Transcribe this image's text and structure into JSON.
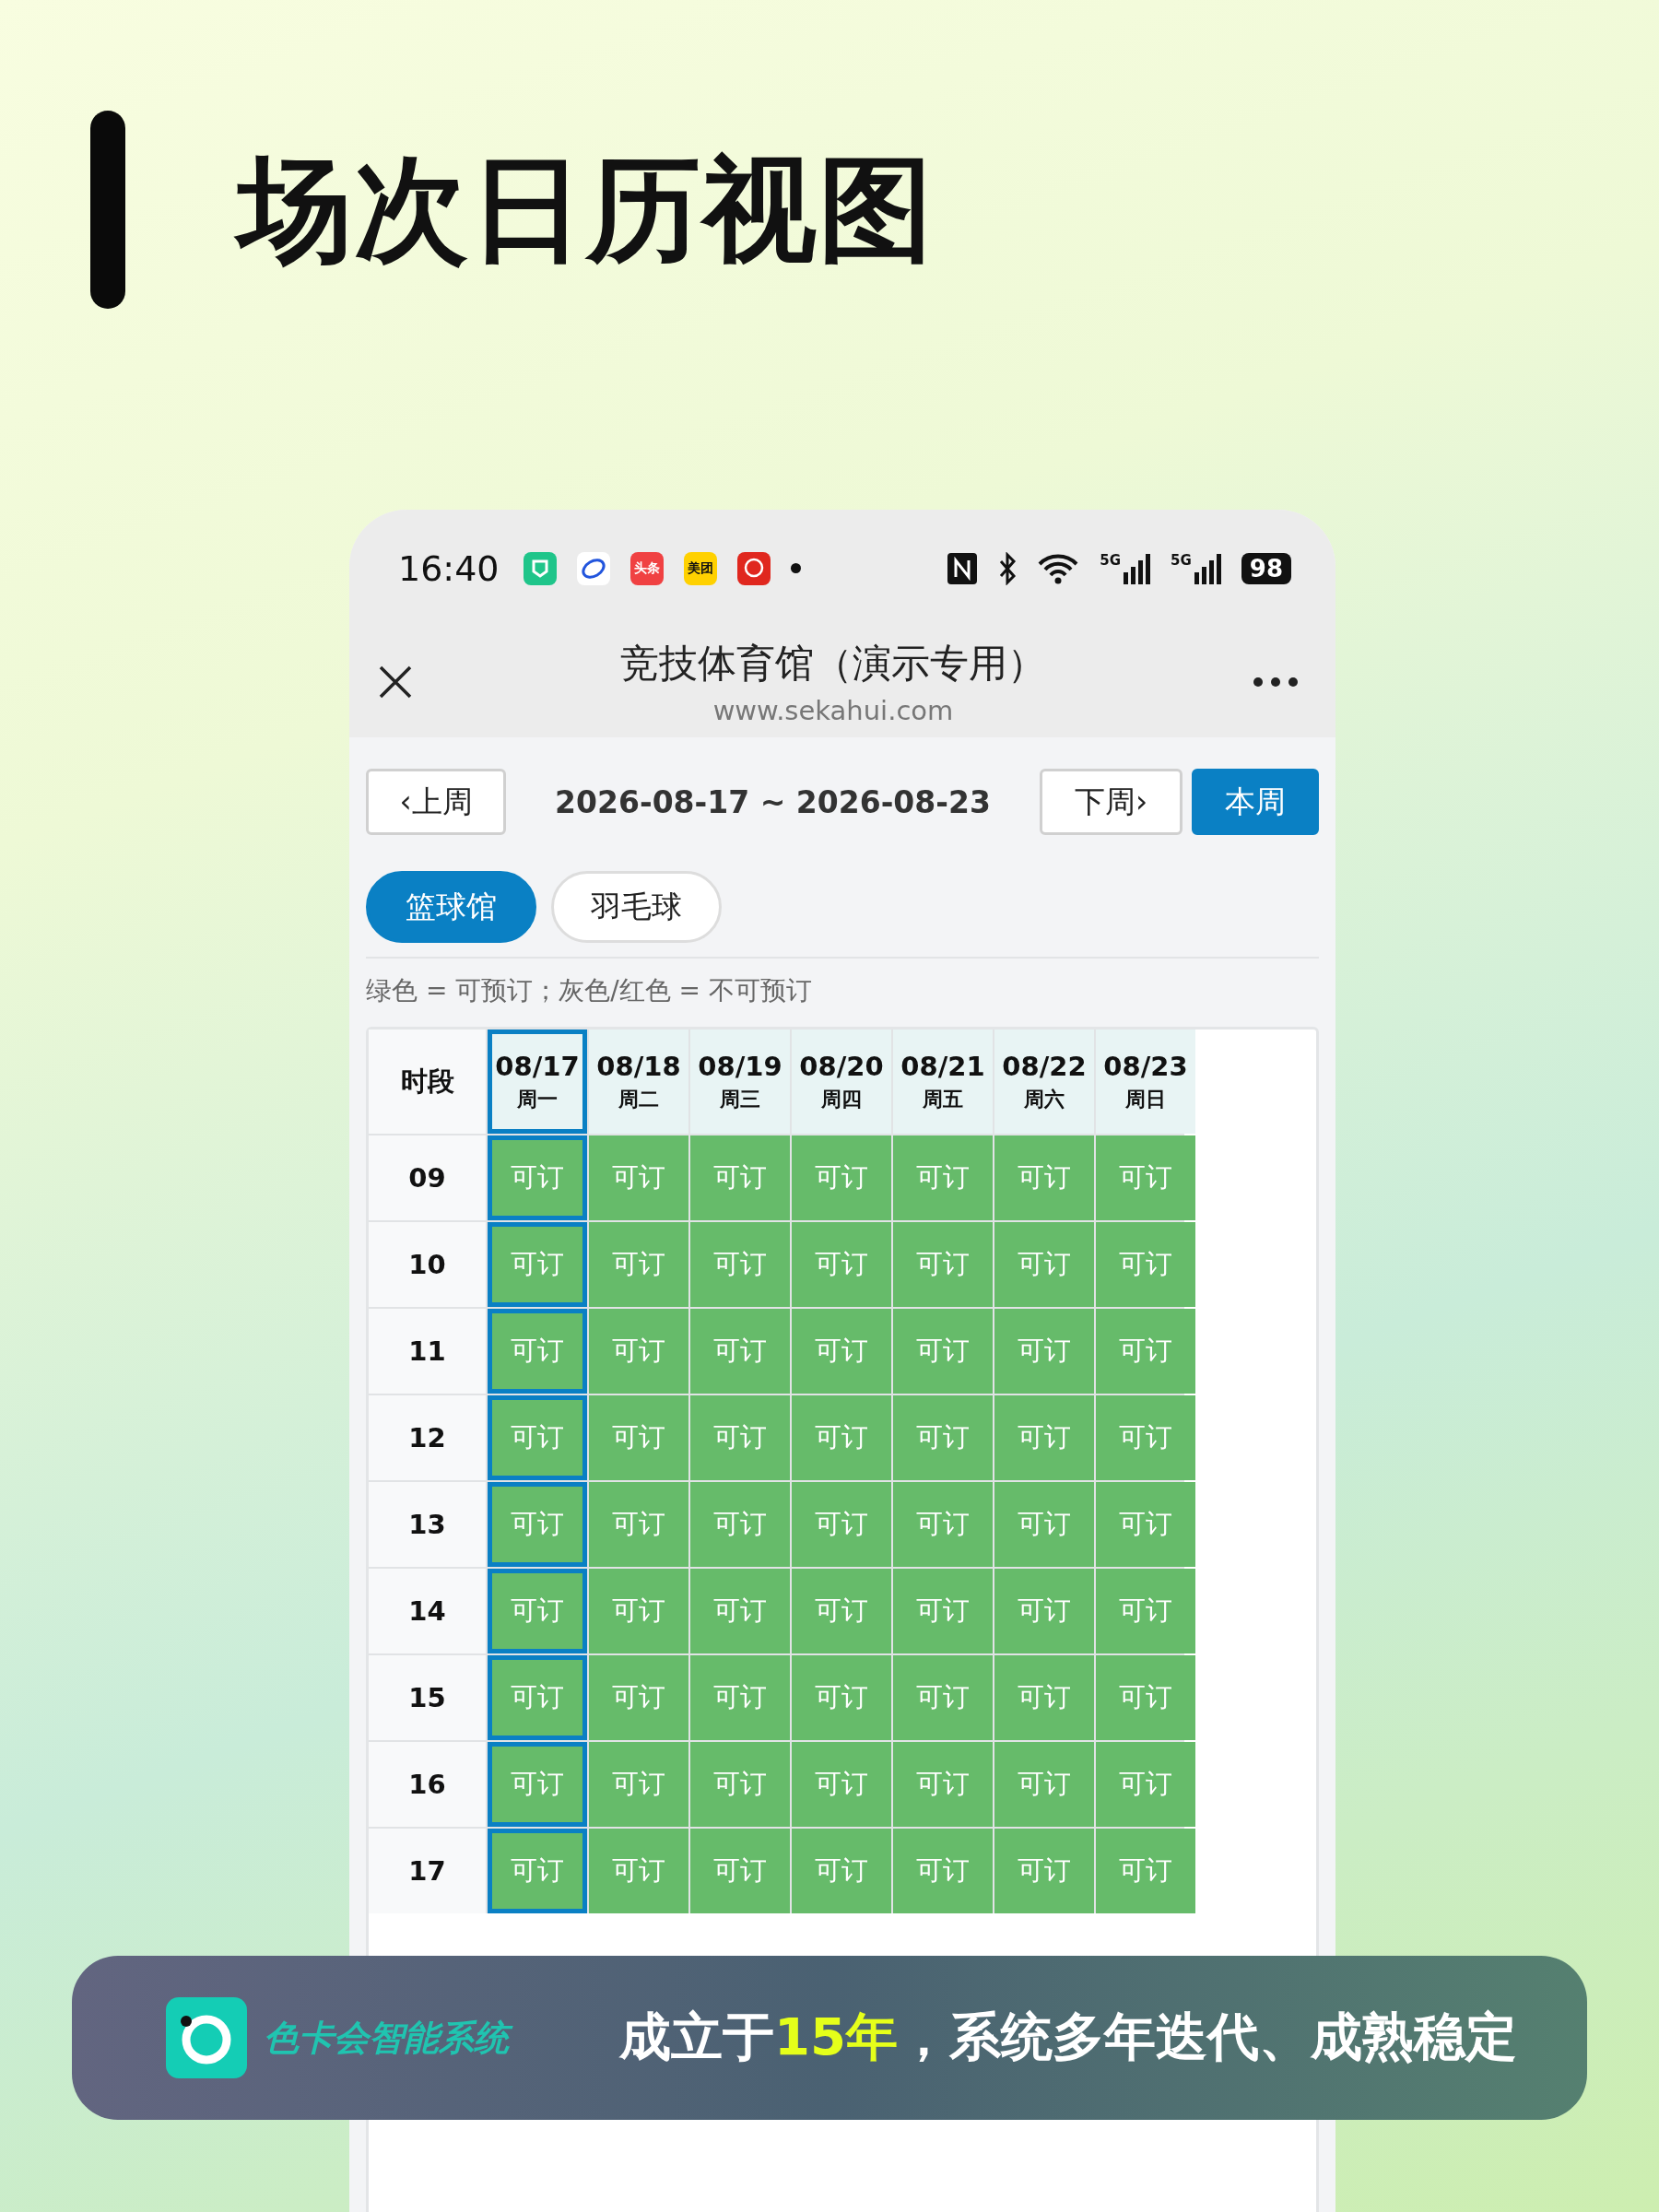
{
  "page_title": "场次日历视图",
  "status_bar": {
    "time": "16:40",
    "notification_icons": [
      {
        "kind": "green-app"
      },
      {
        "kind": "ring-app"
      },
      {
        "kind": "text-app",
        "label": "头条",
        "color": "#f04142"
      },
      {
        "kind": "text-app",
        "label": "美团",
        "color": "#ffd100"
      },
      {
        "kind": "badge-app"
      },
      {
        "kind": "dot"
      }
    ],
    "network": [
      {
        "label": "5G"
      },
      {
        "label": "5G"
      }
    ],
    "battery": "98"
  },
  "header": {
    "title": "竞技体育馆（演示专用）",
    "url": "www.sekahui.com"
  },
  "week_nav": {
    "prev": "‹上周",
    "range": "2026-08-17 ~ 2026-08-23",
    "next": "下周›",
    "current": "本周"
  },
  "venues": [
    {
      "label": "篮球馆",
      "selected": true
    },
    {
      "label": "羽毛球",
      "selected": false
    }
  ],
  "hint": "绿色 = 可预订；灰色/红色 = 不可预订",
  "table": {
    "corner": "时段",
    "days": [
      {
        "date": "08/17",
        "weekday": "周一",
        "selected": true
      },
      {
        "date": "08/18",
        "weekday": "周二",
        "selected": false
      },
      {
        "date": "08/19",
        "weekday": "周三",
        "selected": false
      },
      {
        "date": "08/20",
        "weekday": "周四",
        "selected": false
      },
      {
        "date": "08/21",
        "weekday": "周五",
        "selected": false
      },
      {
        "date": "08/22",
        "weekday": "周六",
        "selected": false
      },
      {
        "date": "08/23",
        "weekday": "周日",
        "selected": false
      }
    ],
    "rows": [
      {
        "hour": "09",
        "cells": [
          "可订",
          "可订",
          "可订",
          "可订",
          "可订",
          "可订",
          "可订"
        ]
      },
      {
        "hour": "10",
        "cells": [
          "可订",
          "可订",
          "可订",
          "可订",
          "可订",
          "可订",
          "可订"
        ]
      },
      {
        "hour": "11",
        "cells": [
          "可订",
          "可订",
          "可订",
          "可订",
          "可订",
          "可订",
          "可订"
        ]
      },
      {
        "hour": "12",
        "cells": [
          "可订",
          "可订",
          "可订",
          "可订",
          "可订",
          "可订",
          "可订"
        ]
      },
      {
        "hour": "13",
        "cells": [
          "可订",
          "可订",
          "可订",
          "可订",
          "可订",
          "可订",
          "可订"
        ]
      },
      {
        "hour": "14",
        "cells": [
          "可订",
          "可订",
          "可订",
          "可订",
          "可订",
          "可订",
          "可订"
        ]
      },
      {
        "hour": "15",
        "cells": [
          "可订",
          "可订",
          "可订",
          "可订",
          "可订",
          "可订",
          "可订"
        ]
      },
      {
        "hour": "16",
        "cells": [
          "可订",
          "可订",
          "可订",
          "可订",
          "可订",
          "可订",
          "可订"
        ]
      },
      {
        "hour": "17",
        "cells": [
          "可订",
          "可订",
          "可订",
          "可订",
          "可订",
          "可订",
          "可订"
        ]
      }
    ]
  },
  "banner": {
    "brand": "色卡会智能系统",
    "slogan": "成立于**15年**，系统多年迭代、成熟稳定"
  }
}
